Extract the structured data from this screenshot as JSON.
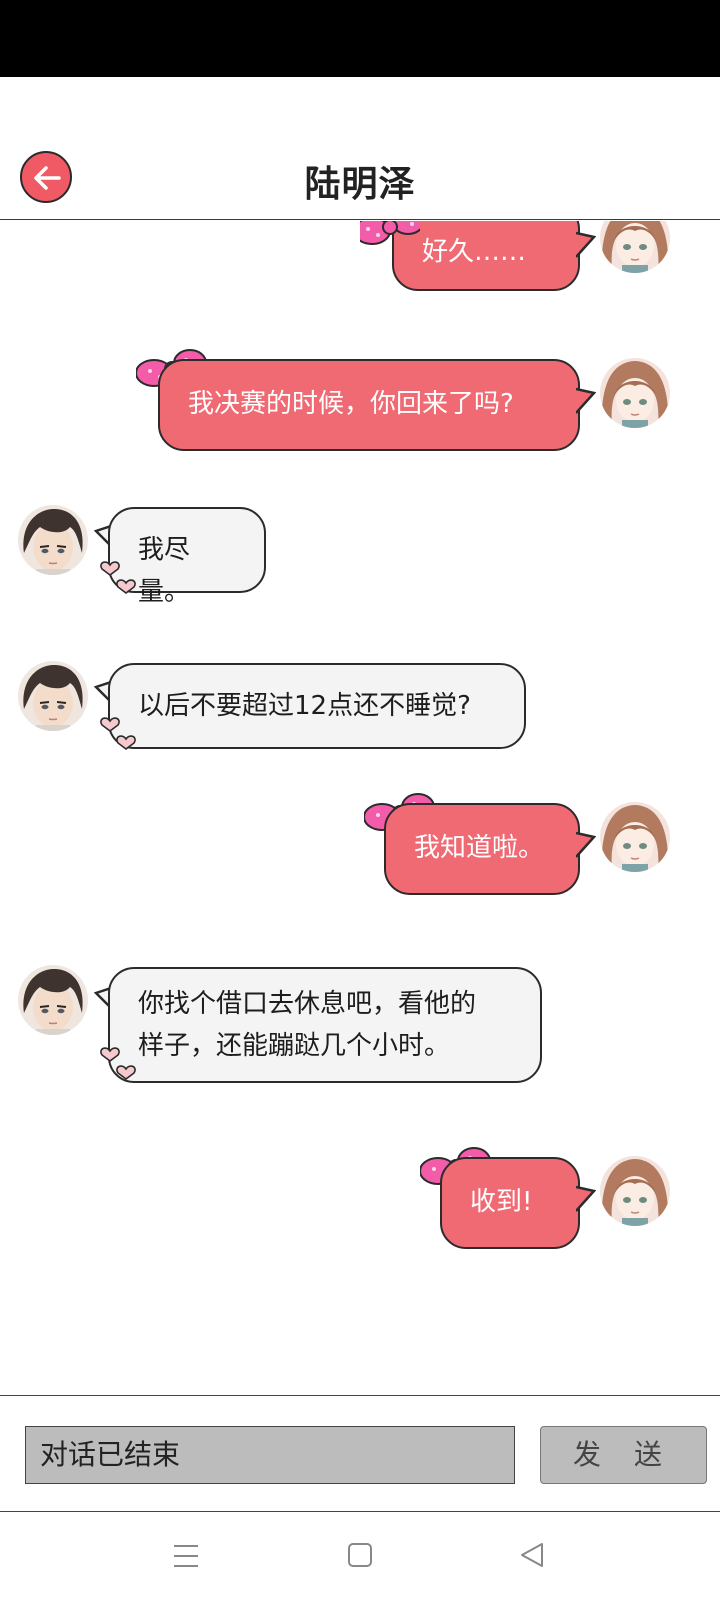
{
  "header": {
    "title": "陆明泽"
  },
  "messages": [
    {
      "from": "me",
      "lines": [
        "好久……"
      ]
    },
    {
      "from": "me",
      "lines": [
        "我决赛的时候，你回来了吗?"
      ]
    },
    {
      "from": "them",
      "lines": [
        "我尽量。"
      ]
    },
    {
      "from": "them",
      "lines": [
        "以后不要超过12点还不睡觉?"
      ]
    },
    {
      "from": "me",
      "lines": [
        "我知道啦。"
      ]
    },
    {
      "from": "them",
      "lines": [
        "你找个借口去休息吧，看他的",
        "样子，还能蹦跶几个小时。"
      ]
    },
    {
      "from": "me",
      "lines": [
        "收到!"
      ]
    }
  ],
  "input": {
    "value": "对话已结束",
    "send_label": "发 送"
  },
  "colors": {
    "my_bubble": "#f06a74",
    "their_bubble": "#f4f4f4",
    "back_button": "#ef5a64",
    "bow": "#f25ca8"
  },
  "icons": {
    "back": "arrow-left-icon",
    "bow": "bow-icon",
    "hearts": "heart-icon",
    "nav_menu": "menu-icon",
    "nav_home": "square-icon",
    "nav_back": "triangle-back-icon"
  }
}
